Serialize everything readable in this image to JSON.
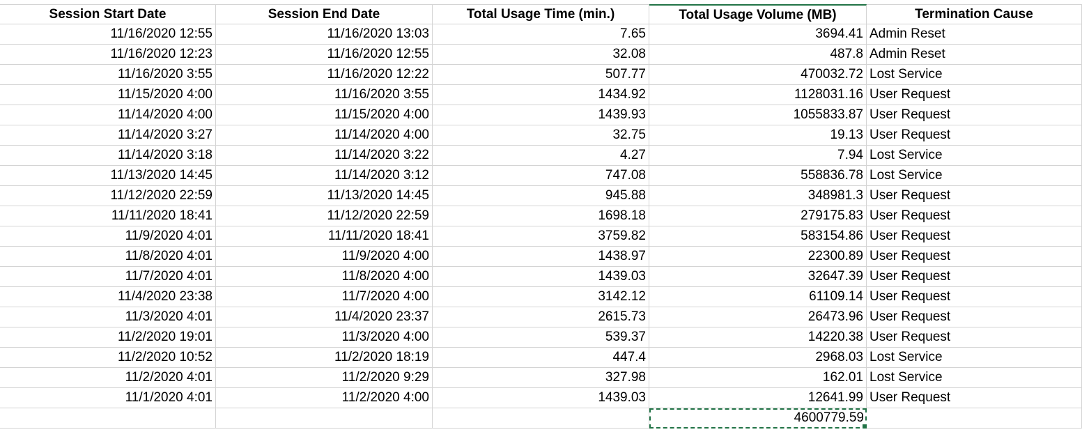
{
  "headers": [
    "Session Start Date",
    "Session End Date",
    "Total Usage Time (min.)",
    "Total Usage Volume (MB)",
    "Termination Cause"
  ],
  "rows": [
    [
      "11/16/2020 12:55",
      "11/16/2020 13:03",
      "7.65",
      "3694.41",
      "Admin Reset"
    ],
    [
      "11/16/2020 12:23",
      "11/16/2020 12:55",
      "32.08",
      "487.8",
      "Admin Reset"
    ],
    [
      "11/16/2020 3:55",
      "11/16/2020 12:22",
      "507.77",
      "470032.72",
      "Lost Service"
    ],
    [
      "11/15/2020 4:00",
      "11/16/2020 3:55",
      "1434.92",
      "1128031.16",
      "User Request"
    ],
    [
      "11/14/2020 4:00",
      "11/15/2020 4:00",
      "1439.93",
      "1055833.87",
      "User Request"
    ],
    [
      "11/14/2020 3:27",
      "11/14/2020 4:00",
      "32.75",
      "19.13",
      "User Request"
    ],
    [
      "11/14/2020 3:18",
      "11/14/2020 3:22",
      "4.27",
      "7.94",
      "Lost Service"
    ],
    [
      "11/13/2020 14:45",
      "11/14/2020 3:12",
      "747.08",
      "558836.78",
      "Lost Service"
    ],
    [
      "11/12/2020 22:59",
      "11/13/2020 14:45",
      "945.88",
      "348981.3",
      "User Request"
    ],
    [
      "11/11/2020 18:41",
      "11/12/2020 22:59",
      "1698.18",
      "279175.83",
      "User Request"
    ],
    [
      "11/9/2020 4:01",
      "11/11/2020 18:41",
      "3759.82",
      "583154.86",
      "User Request"
    ],
    [
      "11/8/2020 4:01",
      "11/9/2020 4:00",
      "1438.97",
      "22300.89",
      "User Request"
    ],
    [
      "11/7/2020 4:01",
      "11/8/2020 4:00",
      "1439.03",
      "32647.39",
      "User Request"
    ],
    [
      "11/4/2020 23:38",
      "11/7/2020 4:00",
      "3142.12",
      "61109.14",
      "User Request"
    ],
    [
      "11/3/2020 4:01",
      "11/4/2020 23:37",
      "2615.73",
      "26473.96",
      "User Request"
    ],
    [
      "11/2/2020 19:01",
      "11/3/2020 4:00",
      "539.37",
      "14220.38",
      "User Request"
    ],
    [
      "11/2/2020 10:52",
      "11/2/2020 18:19",
      "447.4",
      "2968.03",
      "Lost Service"
    ],
    [
      "11/2/2020 4:01",
      "11/2/2020 9:29",
      "327.98",
      "162.01",
      "Lost Service"
    ],
    [
      "11/1/2020 4:01",
      "11/2/2020 4:00",
      "1439.03",
      "12641.99",
      "User Request"
    ]
  ],
  "total_row": [
    "",
    "",
    "",
    "4600779.59",
    ""
  ],
  "colors": {
    "selection": "#217346",
    "gridline": "#d4d4d4"
  }
}
